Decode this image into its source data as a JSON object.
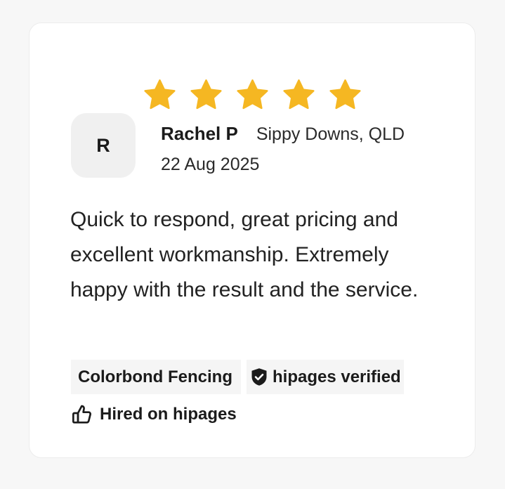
{
  "rating": {
    "value": 5,
    "max": 5,
    "star_color": "#f5b722"
  },
  "reviewer": {
    "initial": "R",
    "name": "Rachel P",
    "location": "Sippy Downs, QLD",
    "date": "22 Aug 2025"
  },
  "review": {
    "text": "Quick to respond, great pricing and excellent workmanship. Extremely happy with the result and the service."
  },
  "tags": {
    "category": "Colorbond Fencing",
    "verified_label": "hipages verified",
    "verified_icon": "shield-check-icon"
  },
  "hired": {
    "label": "Hired on hipages",
    "icon": "thumbs-up-icon"
  }
}
